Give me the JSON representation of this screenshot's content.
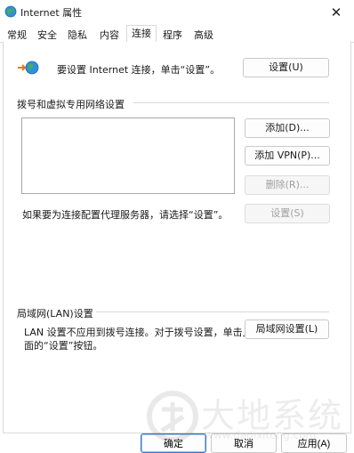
{
  "window": {
    "title": "Internet 属性",
    "close_glyph": "✕"
  },
  "tabs": [
    {
      "label": "常规"
    },
    {
      "label": "安全"
    },
    {
      "label": "隐私"
    },
    {
      "label": "内容"
    },
    {
      "label": "连接",
      "active": true
    },
    {
      "label": "程序"
    },
    {
      "label": "高级"
    }
  ],
  "setup": {
    "text": "要设置 Internet 连接，单击“设置”。",
    "button": "设置(U)"
  },
  "dialup": {
    "group_label": "拨号和虚拟专用网络设置",
    "add_button": "添加(D)...",
    "add_vpn_button": "添加 VPN(P)...",
    "remove_button": "删除(R)...",
    "settings_button": "设置(S)",
    "proxy_hint": "如果要为连接配置代理服务器，请选择“设置”。"
  },
  "lan": {
    "group_label": "局域网(LAN)设置",
    "description_line1": "LAN 设置不应用到拨号连接。对于拨号设置，单击上",
    "description_line2": "面的“设置”按钮。",
    "button": "局域网设置(L)"
  },
  "footer": {
    "ok": "确定",
    "cancel": "取消",
    "apply": "应用(A)"
  },
  "watermark": {
    "text": "大地系统",
    "url": "www.dadixitong.com"
  },
  "colors": {
    "accent": "#3a78c8",
    "disabled_text": "#a0a0a0",
    "border": "#d9d9d9"
  }
}
